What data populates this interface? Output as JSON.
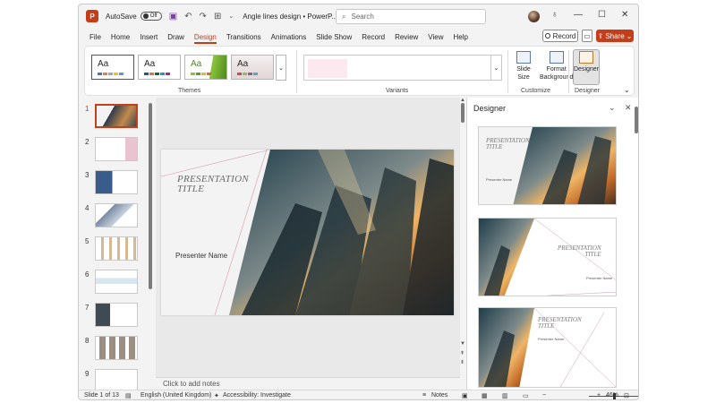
{
  "titlebar": {
    "autosave_label": "AutoSave",
    "autosave_state": "Off",
    "doc_title": "Angle lines design  •  PowerP...",
    "search_placeholder": "Search"
  },
  "menu": [
    "File",
    "Home",
    "Insert",
    "Draw",
    "Design",
    "Transitions",
    "Animations",
    "Slide Show",
    "Record",
    "Review",
    "View",
    "Help"
  ],
  "menu_active": "Design",
  "actions": {
    "record": "Record",
    "share": "Share"
  },
  "ribbon": {
    "theme_sample": "Aa",
    "themes_label": "Themes",
    "variants_label": "Variants",
    "slide_size": "Slide Size",
    "format_background_1": "Format",
    "format_background_2": "Background",
    "customize_label": "Customize",
    "designer_button": "Designer",
    "designer_label": "Designer"
  },
  "thumbnails": [
    "1",
    "2",
    "3",
    "4",
    "5",
    "6",
    "7",
    "8",
    "9"
  ],
  "slide": {
    "title_line1": "PRESENTATION",
    "title_line2": "TITLE",
    "presenter": "Presenter Name"
  },
  "notes_placeholder": "Click to add notes",
  "designer_pane": {
    "title": "Designer",
    "opt_title_line1": "PRESENTATION",
    "opt_title_line2": "TITLE",
    "opt_presenter": "Presenter Name"
  },
  "statusbar": {
    "slide_count": "Slide 1 of 13",
    "language": "English (United Kingdom)",
    "accessibility": "Accessibility: Investigate",
    "notes": "Notes",
    "zoom": "46%"
  },
  "colors": {
    "accent": "#c43e1c",
    "window_bg": "#f3f3f3",
    "ribbon_bg": "#ffffff"
  }
}
